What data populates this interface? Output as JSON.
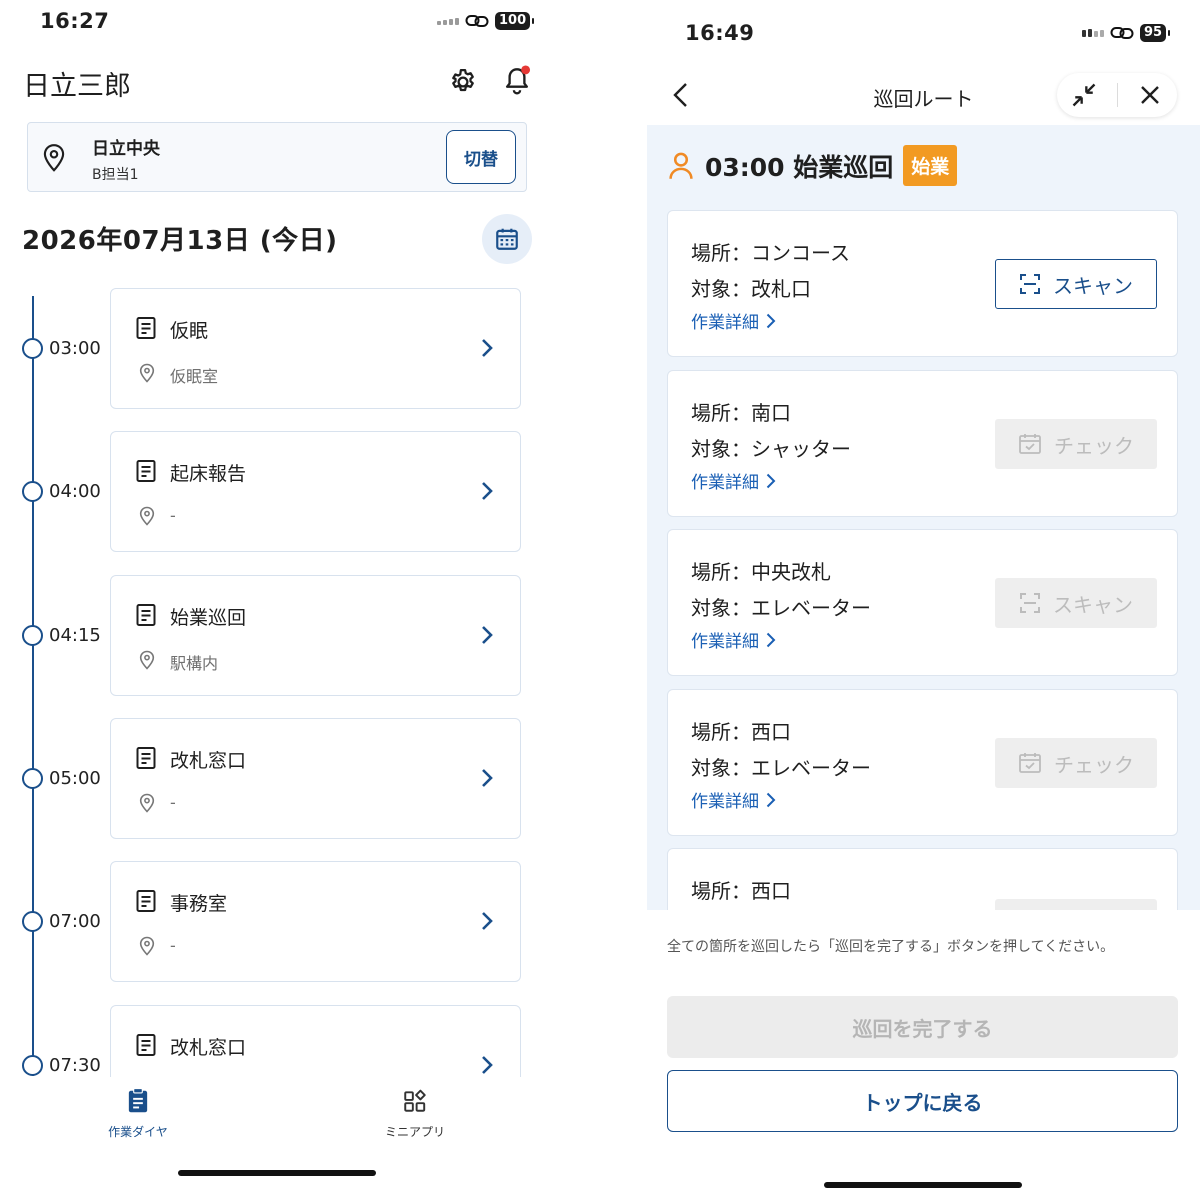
{
  "left": {
    "status": {
      "time": "16:27",
      "battery": "100"
    },
    "title": "日立三郎",
    "location": {
      "name": "日立中央",
      "sub": "B担当1",
      "switch_label": "切替"
    },
    "date": "2026年07月13日 (今日)",
    "tasks": [
      {
        "time": "03:00",
        "title": "仮眠",
        "place": "仮眠室"
      },
      {
        "time": "04:00",
        "title": "起床報告",
        "place": "-"
      },
      {
        "time": "04:15",
        "title": "始業巡回",
        "place": "駅構内"
      },
      {
        "time": "05:00",
        "title": "改札窓口",
        "place": "-"
      },
      {
        "time": "07:00",
        "title": "事務室",
        "place": "-"
      },
      {
        "time": "07:30",
        "title": "改札窓口",
        "place": ""
      }
    ],
    "nav": {
      "work_label": "作業ダイヤ",
      "mini_label": "ミニアプリ"
    }
  },
  "right": {
    "status": {
      "time": "16:49",
      "battery": "95"
    },
    "title": "巡回ルート",
    "heading": "03:00 始業巡回",
    "badge": "始業",
    "detail_label": "作業詳細",
    "points": [
      {
        "place": "場所：コンコース",
        "target": "対象：改札口",
        "action": "スキャン",
        "enabled": true
      },
      {
        "place": "場所：南口",
        "target": "対象：シャッター",
        "action": "チェック",
        "enabled": false
      },
      {
        "place": "場所：中央改札",
        "target": "対象：エレベーター",
        "action": "スキャン",
        "enabled": false
      },
      {
        "place": "場所：西口",
        "target": "対象：エレベーター",
        "action": "チェック",
        "enabled": false
      },
      {
        "place": "場所：西口",
        "target": "",
        "action": "",
        "enabled": false
      }
    ],
    "note": "全ての箇所を巡回したら「巡回を完了する」ボタンを押してください。",
    "complete_label": "巡回を完了する",
    "top_label": "トップに戻る"
  },
  "colors": {
    "primary": "#1a4f8b",
    "link": "#1a5fb4",
    "badge": "#f29a22",
    "person_icon": "#f08a24",
    "notify_dot": "#e53935"
  }
}
